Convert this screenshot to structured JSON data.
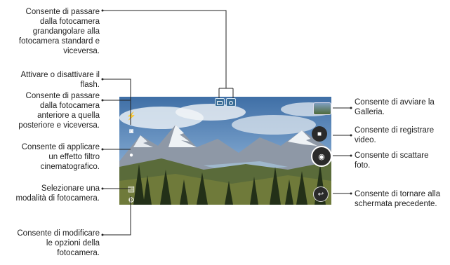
{
  "callouts_left": [
    {
      "id": "lens",
      "text": "Consente di passare\ndalla fotocamera\ngrandangolare alla\nfotocamera standard e\nviceversa."
    },
    {
      "id": "flash",
      "text": "Attivare o disattivare il\nflash."
    },
    {
      "id": "switch",
      "text": "Consente di passare\ndalla fotocamera\nanteriore a quella\nposteriore e viceversa."
    },
    {
      "id": "filter",
      "text": "Consente di applicare\nun effetto filtro\ncinematografico."
    },
    {
      "id": "mode",
      "text": "Selezionare una\nmodalità di fotocamera."
    },
    {
      "id": "settings",
      "text": "Consente di modificare\nle opzioni della\nfotocamera."
    }
  ],
  "callouts_right": [
    {
      "id": "gallery",
      "text": "Consente di avviare la\nGalleria."
    },
    {
      "id": "video",
      "text": "Consente di registrare\nvideo."
    },
    {
      "id": "photo",
      "text": "Consente di scattare\nfoto."
    },
    {
      "id": "back",
      "text": "Consente di tornare alla\nschermata precedente."
    }
  ],
  "colors": {
    "sky": "#4c7fb5",
    "mountain": "#8a93a0",
    "snow": "#eef2f5",
    "forest": "#2d3a22",
    "grass": "#6f7a3a",
    "line": "#222222"
  }
}
